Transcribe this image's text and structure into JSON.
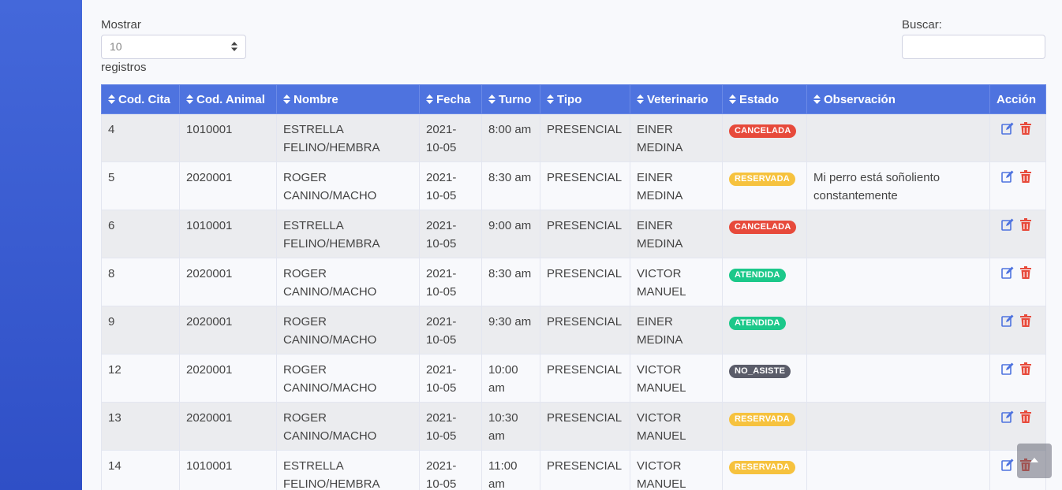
{
  "length_control": {
    "label": "Mostrar",
    "selected": "10",
    "suffix": "registros"
  },
  "search": {
    "label": "Buscar:",
    "value": ""
  },
  "table": {
    "columns": [
      "Cod. Cita",
      "Cod. Animal",
      "Nombre",
      "Fecha",
      "Turno",
      "Tipo",
      "Veterinario",
      "Estado",
      "Observación",
      "Acción"
    ],
    "rows": [
      {
        "cod_cita": "4",
        "cod_animal": "1010001",
        "nombre": [
          "ESTRELLA",
          "FELINO/HEMBRA"
        ],
        "fecha": [
          "2021-",
          "10-05"
        ],
        "turno": [
          "8:00 am",
          ""
        ],
        "tipo": "PRESENCIAL",
        "veterinario": [
          "EINER",
          "MEDINA"
        ],
        "estado": "CANCELADA",
        "observacion": [
          "",
          ""
        ]
      },
      {
        "cod_cita": "5",
        "cod_animal": "2020001",
        "nombre": [
          "ROGER",
          "CANINO/MACHO"
        ],
        "fecha": [
          "2021-",
          "10-05"
        ],
        "turno": [
          "8:30 am",
          ""
        ],
        "tipo": "PRESENCIAL",
        "veterinario": [
          "EINER",
          "MEDINA"
        ],
        "estado": "RESERVADA",
        "observacion": [
          "Mi perro está soñoliento",
          "constantemente"
        ]
      },
      {
        "cod_cita": "6",
        "cod_animal": "1010001",
        "nombre": [
          "ESTRELLA",
          "FELINO/HEMBRA"
        ],
        "fecha": [
          "2021-",
          "10-05"
        ],
        "turno": [
          "9:00 am",
          ""
        ],
        "tipo": "PRESENCIAL",
        "veterinario": [
          "EINER",
          "MEDINA"
        ],
        "estado": "CANCELADA",
        "observacion": [
          "",
          ""
        ]
      },
      {
        "cod_cita": "8",
        "cod_animal": "2020001",
        "nombre": [
          "ROGER",
          "CANINO/MACHO"
        ],
        "fecha": [
          "2021-",
          "10-05"
        ],
        "turno": [
          "8:30 am",
          ""
        ],
        "tipo": "PRESENCIAL",
        "veterinario": [
          "VICTOR",
          "MANUEL"
        ],
        "estado": "ATENDIDA",
        "observacion": [
          "",
          ""
        ]
      },
      {
        "cod_cita": "9",
        "cod_animal": "2020001",
        "nombre": [
          "ROGER",
          "CANINO/MACHO"
        ],
        "fecha": [
          "2021-",
          "10-05"
        ],
        "turno": [
          "9:30 am",
          ""
        ],
        "tipo": "PRESENCIAL",
        "veterinario": [
          "EINER",
          "MEDINA"
        ],
        "estado": "ATENDIDA",
        "observacion": [
          "",
          ""
        ]
      },
      {
        "cod_cita": "12",
        "cod_animal": "2020001",
        "nombre": [
          "ROGER",
          "CANINO/MACHO"
        ],
        "fecha": [
          "2021-",
          "10-05"
        ],
        "turno": [
          "10:00",
          "am"
        ],
        "tipo": "PRESENCIAL",
        "veterinario": [
          "VICTOR",
          "MANUEL"
        ],
        "estado": "NO_ASISTE",
        "observacion": [
          "",
          ""
        ]
      },
      {
        "cod_cita": "13",
        "cod_animal": "2020001",
        "nombre": [
          "ROGER",
          "CANINO/MACHO"
        ],
        "fecha": [
          "2021-",
          "10-05"
        ],
        "turno": [
          "10:30",
          "am"
        ],
        "tipo": "PRESENCIAL",
        "veterinario": [
          "VICTOR",
          "MANUEL"
        ],
        "estado": "RESERVADA",
        "observacion": [
          "",
          ""
        ]
      },
      {
        "cod_cita": "14",
        "cod_animal": "1010001",
        "nombre": [
          "ESTRELLA",
          "FELINO/HEMBRA"
        ],
        "fecha": [
          "2021-",
          "10-05"
        ],
        "turno": [
          "11:00",
          "am"
        ],
        "tipo": "PRESENCIAL",
        "veterinario": [
          "VICTOR",
          "MANUEL"
        ],
        "estado": "RESERVADA",
        "observacion": [
          "",
          ""
        ]
      }
    ]
  },
  "status_colors": {
    "CANCELADA": "#e74a3b",
    "RESERVADA": "#f6c23e",
    "ATENDIDA": "#1cc88a",
    "NO_ASISTE": "#5a5c69"
  },
  "icons": {
    "sort": "sort-icon",
    "edit": "edit-icon",
    "delete": "trash-icon",
    "scroll_top": "arrow-up-icon"
  },
  "colors": {
    "header": "#4e73df",
    "sidebar": "#4468da",
    "edit": "#4e73df",
    "delete": "#e74a3b"
  }
}
